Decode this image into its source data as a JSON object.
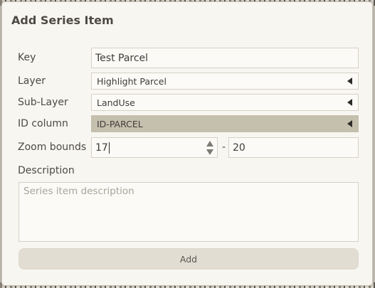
{
  "dialog": {
    "title": "Add Series Item"
  },
  "form": {
    "key": {
      "label": "Key",
      "value": "Test Parcel"
    },
    "layer": {
      "label": "Layer",
      "value": "Highlight Parcel"
    },
    "sub_layer": {
      "label": "Sub-Layer",
      "value": "LandUse"
    },
    "id_column": {
      "label": "ID column",
      "value": "ID-PARCEL"
    },
    "zoom_bounds": {
      "label": "Zoom bounds",
      "min_value": "17",
      "separator": "-",
      "max_value": "20"
    },
    "description": {
      "label": "Description",
      "placeholder": "Series item description",
      "value": ""
    },
    "add_button_label": "Add"
  },
  "colors": {
    "dialog_background": "#f8f6f1",
    "selected_dropdown_background": "#c5bfad",
    "button_background": "#e2ddd3"
  },
  "icons": {
    "dropdown": "caret-left-icon",
    "spinner": "stepper-arrows-icon"
  }
}
